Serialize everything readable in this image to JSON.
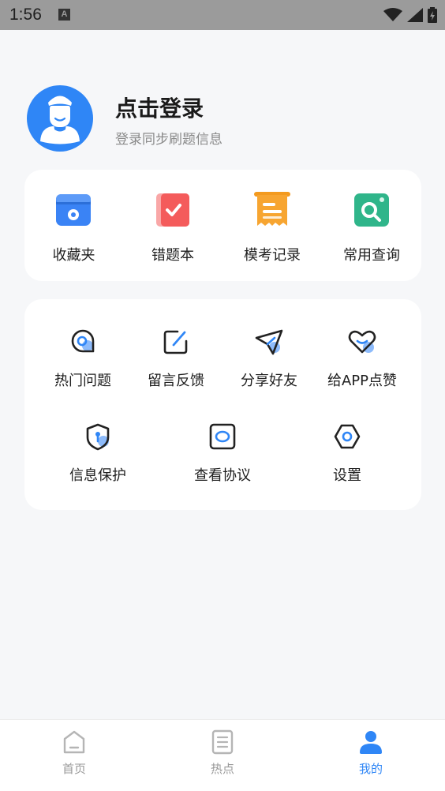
{
  "status_bar": {
    "time": "1:56",
    "notification_icon": "A"
  },
  "profile": {
    "title": "点击登录",
    "subtitle": "登录同步刷题信息"
  },
  "quick_tools": [
    {
      "label": "收藏夹",
      "icon": "folder-icon",
      "color": "#3a83f5"
    },
    {
      "label": "错题本",
      "icon": "wrong-book-icon",
      "color": "#f45b5b"
    },
    {
      "label": "模考记录",
      "icon": "receipt-icon",
      "color": "#f7a531"
    },
    {
      "label": "常用查询",
      "icon": "image-search-icon",
      "color": "#2fb58a"
    }
  ],
  "services": [
    {
      "label": "热门问题",
      "icon": "chat-bubble-icon"
    },
    {
      "label": "留言反馈",
      "icon": "edit-icon"
    },
    {
      "label": "分享好友",
      "icon": "paper-plane-icon"
    },
    {
      "label": "给APP点赞",
      "icon": "heart-icon"
    },
    {
      "label": "信息保护",
      "icon": "shield-icon"
    },
    {
      "label": "查看协议",
      "icon": "agreement-icon"
    },
    {
      "label": "设置",
      "icon": "settings-hexagon-icon"
    }
  ],
  "tabs": [
    {
      "label": "首页",
      "icon": "home-icon",
      "active": false
    },
    {
      "label": "热点",
      "icon": "news-icon",
      "active": false
    },
    {
      "label": "我的",
      "icon": "user-icon",
      "active": true
    }
  ],
  "colors": {
    "accent": "#2f86f6",
    "background": "#f6f7f9",
    "status_bar": "#9b9b9b"
  }
}
